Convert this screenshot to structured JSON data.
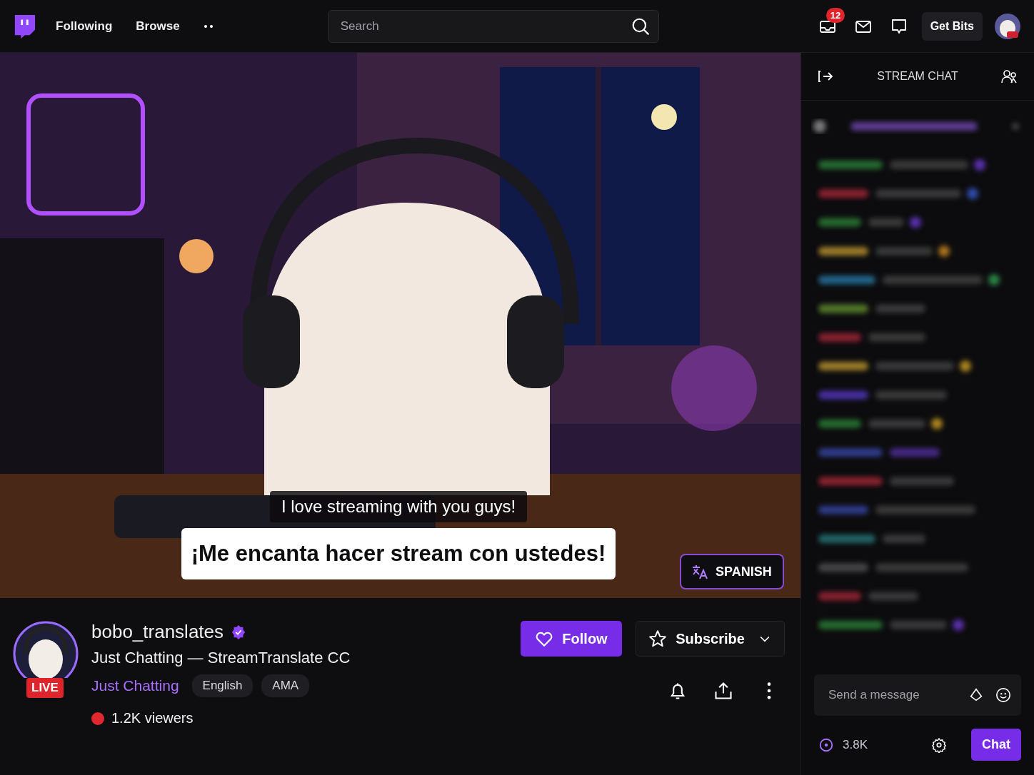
{
  "top_bar": {
    "nav": [
      {
        "label": "Following"
      },
      {
        "label": "Browse"
      }
    ],
    "search": {
      "placeholder": "Search"
    },
    "inbox_badge": "12",
    "get_bits": "Get Bits"
  },
  "video": {
    "caption_original": "I love streaming with you guys!",
    "caption_translated": "¡Me encanta hacer stream con ustedes!",
    "language_button": "SPANISH"
  },
  "channel": {
    "name": "bobo_translates",
    "verified": true,
    "title": "Just Chatting — StreamTranslate CC",
    "live_badge": "LIVE",
    "category": "Just Chatting",
    "tags": [
      "English",
      "AMA"
    ],
    "viewers": "1.2K viewers"
  },
  "actions": {
    "follow": "Follow",
    "subscribe": "Subscribe"
  },
  "chat": {
    "title": "STREAM CHAT",
    "input": {
      "placeholder": "Send a message"
    },
    "points": "3.8K",
    "send": "Chat"
  }
}
